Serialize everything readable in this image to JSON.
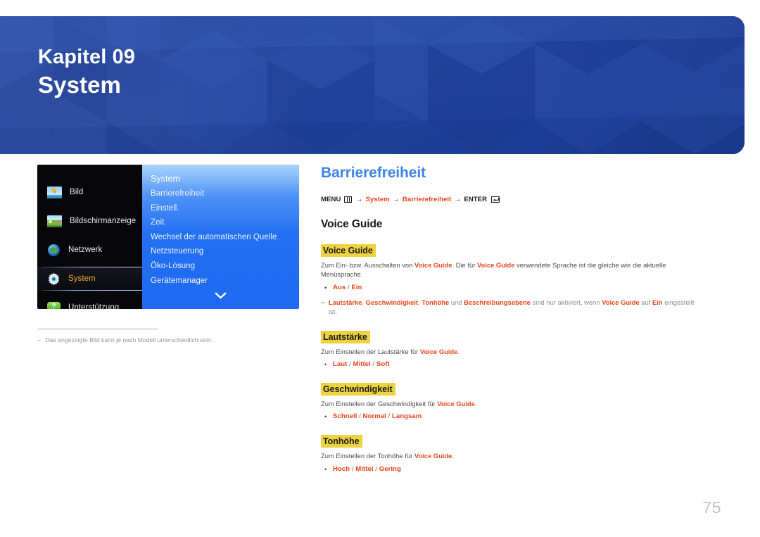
{
  "banner": {
    "chapter_label": "Kapitel 09",
    "chapter_title": "System",
    "bg_color": "#23479f"
  },
  "osd": {
    "left_items": [
      {
        "label": "Bild",
        "icon": "picture-photo-icon",
        "selected": false
      },
      {
        "label": "Bildschirmanzeige",
        "icon": "onscreen-display-photo-icon",
        "selected": false
      },
      {
        "label": "Netzwerk",
        "icon": "globe-icon",
        "selected": false
      },
      {
        "label": "System",
        "icon": "gear-icon",
        "selected": true
      },
      {
        "label": "Unterstützung",
        "icon": "question-bubble-icon",
        "selected": false
      }
    ],
    "panel_title": "System",
    "panel_items": [
      "Barrierefreiheit",
      "Einstell.",
      "Zeit",
      "Wechsel der automatischen Quelle",
      "Netzsteuerung",
      "Öko-Lösung",
      "Gerätemanager"
    ],
    "scroll_more_icon": "chevron-down-icon",
    "selected_color": "#f0a92a",
    "panel_accent": "#1e6af1"
  },
  "footnote": {
    "dash": "‒",
    "text": "Das angezeigte Bild kann je nach Modell unterschiedlich sein."
  },
  "content": {
    "title": "Barrierefreiheit",
    "title_color": "#3d83e8",
    "path": {
      "menu_label": "MENU",
      "menu_icon": "menu-bars-icon",
      "arrow": "→",
      "node1": "System",
      "node2": "Barrierefreiheit",
      "enter_label": "ENTER",
      "enter_icon": "enter-key-icon",
      "accent_color": "#e8441b"
    },
    "section_heading": "Voice Guide",
    "highlight_color": "#ecd33f",
    "blocks": [
      {
        "heading": "Voice Guide",
        "paragraph_parts": [
          {
            "t": "Zum Ein- bzw. Ausschalten von ",
            "b": false
          },
          {
            "t": "Voice Guide",
            "b": true
          },
          {
            "t": ". Die für ",
            "b": false
          },
          {
            "t": "Voice Guide",
            "b": true
          },
          {
            "t": " verwendete Sprache ist die gleiche wie die aktuelle Menüsprache.",
            "b": false
          }
        ],
        "bullet": "•",
        "options": [
          "Aus",
          "Ein"
        ],
        "note_parts": [
          {
            "t": "Lautstärke",
            "b": true
          },
          {
            "t": ", ",
            "b": false
          },
          {
            "t": "Geschwindigkeit",
            "b": true
          },
          {
            "t": ", ",
            "b": false
          },
          {
            "t": "Tonhöhe",
            "b": true
          },
          {
            "t": " und ",
            "b": false
          },
          {
            "t": "Beschreibungsebene",
            "b": true
          },
          {
            "t": " sind nur aktiviert, wenn ",
            "b": false
          },
          {
            "t": "Voice Guide",
            "b": true
          },
          {
            "t": " auf ",
            "b": false
          },
          {
            "t": "Ein",
            "b": true
          },
          {
            "t": " eingestellt ist.",
            "b": false
          }
        ]
      },
      {
        "heading": "Lautstärke",
        "paragraph_parts": [
          {
            "t": "Zum Einstellen der Lautstärke für ",
            "b": false
          },
          {
            "t": "Voice Guide",
            "b": true
          },
          {
            "t": ".",
            "b": false
          }
        ],
        "bullet": "•",
        "options": [
          "Laut",
          "Mittel",
          "Soft"
        ]
      },
      {
        "heading": "Geschwindigkeit",
        "paragraph_parts": [
          {
            "t": "Zum Einstellen der Geschwindigkeit für ",
            "b": false
          },
          {
            "t": "Voice Guide",
            "b": true
          },
          {
            "t": ".",
            "b": false
          }
        ],
        "bullet": "•",
        "options": [
          "Schnell",
          "Normal",
          "Langsam"
        ]
      },
      {
        "heading": "Tonhöhe",
        "paragraph_parts": [
          {
            "t": "Zum Einstellen der Tonhöhe für ",
            "b": false
          },
          {
            "t": "Voice Guide",
            "b": true
          },
          {
            "t": ".",
            "b": false
          }
        ],
        "bullet": "•",
        "options": [
          "Hoch",
          "Mittel",
          "Gering"
        ]
      }
    ]
  },
  "page_number": "75"
}
